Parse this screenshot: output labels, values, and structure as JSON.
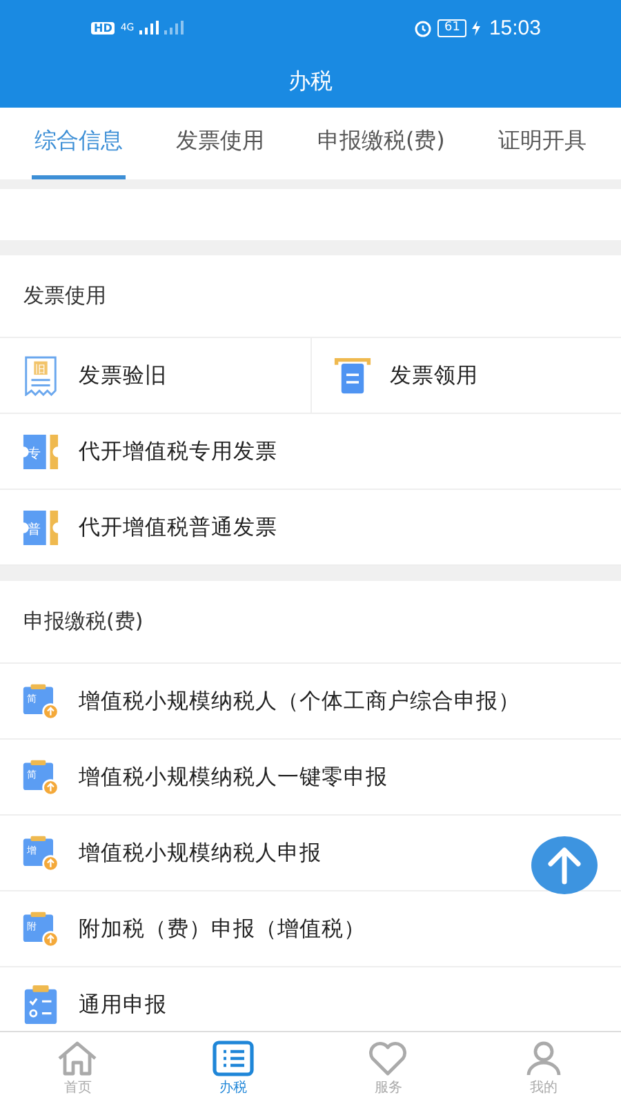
{
  "status_bar": {
    "hd": "HD",
    "network": "4G",
    "battery": "61",
    "charging": true,
    "time": "15:03"
  },
  "header": {
    "title": "办税"
  },
  "tabs": [
    {
      "label": "综合信息",
      "selected": true
    },
    {
      "label": "发票使用",
      "selected": false
    },
    {
      "label": "申报缴税(费)",
      "selected": false
    },
    {
      "label": "证明开具",
      "selected": false
    }
  ],
  "sections": [
    {
      "title": "发票使用",
      "rows": [
        [
          {
            "label": "发票验旧",
            "kind": "receipt",
            "badge": "旧"
          },
          {
            "label": "发票领用",
            "kind": "tray"
          }
        ],
        [
          {
            "label": "代开增值税专用发票",
            "kind": "ticket",
            "badge": "专"
          }
        ],
        [
          {
            "label": "代开增值税普通发票",
            "kind": "ticket",
            "badge": "普"
          }
        ]
      ]
    },
    {
      "title": "申报缴税(费)",
      "rows": [
        [
          {
            "label": "增值税小规模纳税人（个体工商户综合申报）",
            "kind": "declare",
            "badge": "简"
          }
        ],
        [
          {
            "label": "增值税小规模纳税人一键零申报",
            "kind": "declare",
            "badge": "简"
          }
        ],
        [
          {
            "label": "增值税小规模纳税人申报",
            "kind": "declare",
            "badge": "增"
          }
        ],
        [
          {
            "label": "附加税（费）申报（增值税）",
            "kind": "declare",
            "badge": "附"
          }
        ],
        [
          {
            "label": "通用申报",
            "kind": "checklist"
          }
        ]
      ]
    }
  ],
  "nav": [
    {
      "label": "首页",
      "kind": "home",
      "selected": false
    },
    {
      "label": "办税",
      "kind": "list",
      "selected": true
    },
    {
      "label": "服务",
      "kind": "heart",
      "selected": false
    },
    {
      "label": "我的",
      "kind": "person",
      "selected": false
    }
  ]
}
